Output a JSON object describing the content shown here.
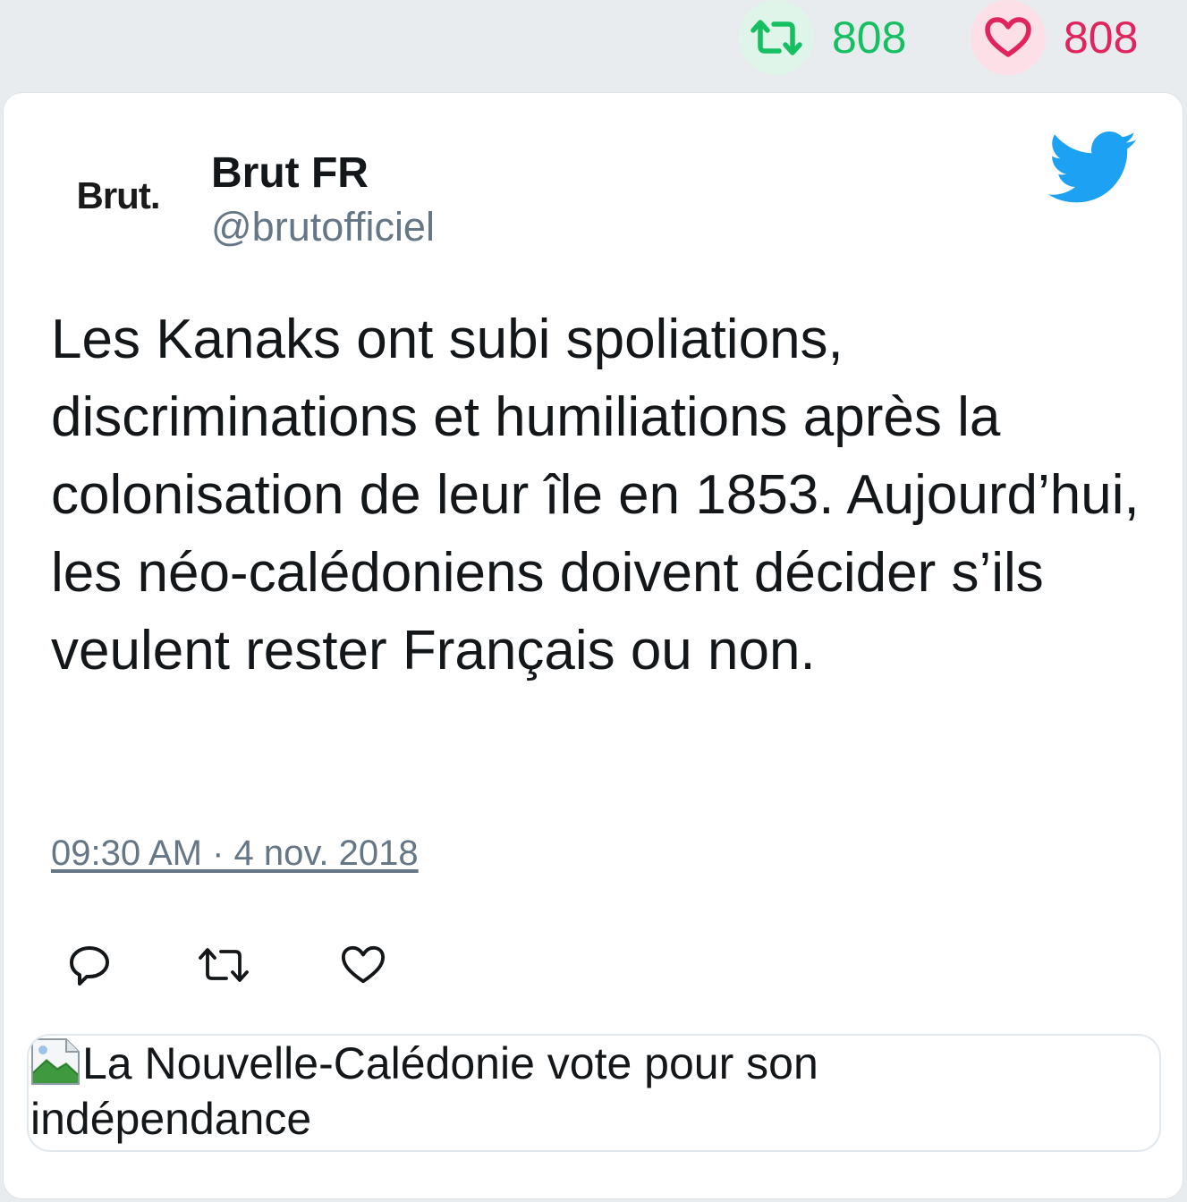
{
  "stats": {
    "retweets": "808",
    "likes": "808",
    "retweet_color": "#17bf63",
    "like_color": "#e0245e"
  },
  "tweet": {
    "avatar_text": "Brut.",
    "author_name": "Brut FR",
    "author_handle": "@brutofficiel",
    "text": "Les Kanaks ont subi spoliations, discriminations et humiliations après la colonisation de leur île en 1853. Aujourd’hui, les néo-calédoniens doivent décider s’ils veulent rester Français ou non.",
    "timestamp": "09:30 AM · 4 nov. 2018",
    "brand_icon": "twitter-bird-icon",
    "brand_color": "#1da1f2"
  },
  "actions": [
    {
      "icon": "reply-icon"
    },
    {
      "icon": "retweet-icon"
    },
    {
      "icon": "like-icon"
    }
  ],
  "preview": {
    "image_alt": "La Nouvelle-Calédonie vote pour son indépendance",
    "icon": "broken-image-icon"
  }
}
